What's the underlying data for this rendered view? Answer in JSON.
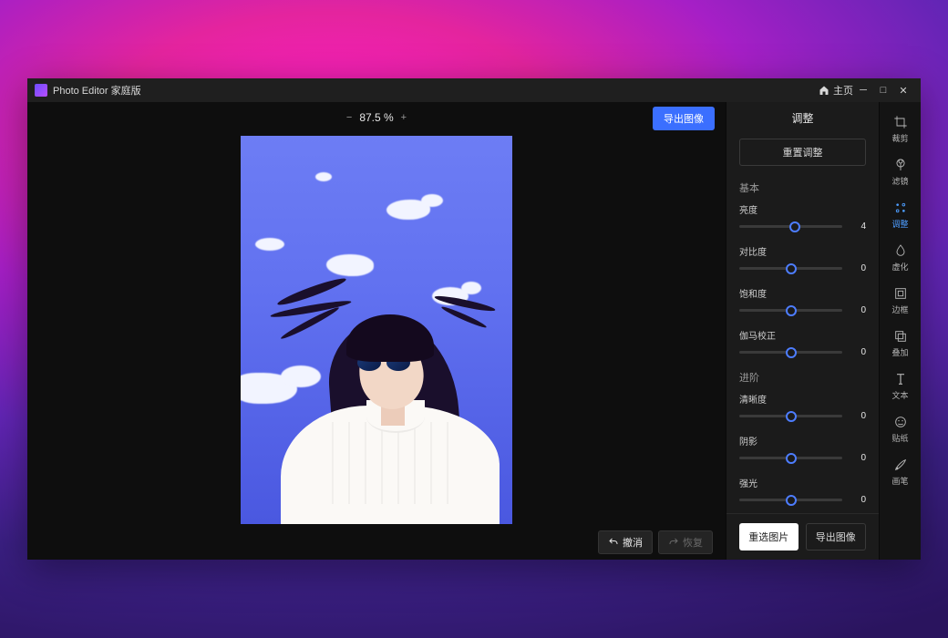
{
  "title": "Photo Editor 家庭版",
  "header": {
    "home": "主页"
  },
  "zoom": "87.5 %",
  "export_top": "导出图像",
  "undo": "撤消",
  "redo": "恢复",
  "panel": {
    "title": "调整",
    "reset": "重置调整",
    "sections": {
      "basic": "基本",
      "advanced": "进阶"
    },
    "sliders": {
      "brightness": {
        "label": "亮度",
        "value": 4,
        "pos": 54
      },
      "contrast": {
        "label": "对比度",
        "value": 0,
        "pos": 50
      },
      "saturation": {
        "label": "饱和度",
        "value": 0,
        "pos": 50
      },
      "gamma": {
        "label": "伽马校正",
        "value": 0,
        "pos": 50
      },
      "clarity": {
        "label": "清晰度",
        "value": 0,
        "pos": 50
      },
      "shadow": {
        "label": "阴影",
        "value": 0,
        "pos": 50
      },
      "highlight": {
        "label": "强光",
        "value": 0,
        "pos": 50
      }
    },
    "reselect": "重选图片",
    "export": "导出图像"
  },
  "tools": [
    {
      "key": "crop",
      "label": "裁剪"
    },
    {
      "key": "filter",
      "label": "滤镜"
    },
    {
      "key": "adjust",
      "label": "调整",
      "active": true
    },
    {
      "key": "blur",
      "label": "虚化"
    },
    {
      "key": "frame",
      "label": "边框"
    },
    {
      "key": "overlay",
      "label": "叠加"
    },
    {
      "key": "text",
      "label": "文本"
    },
    {
      "key": "sticker",
      "label": "贴纸"
    },
    {
      "key": "brush",
      "label": "画笔"
    }
  ]
}
